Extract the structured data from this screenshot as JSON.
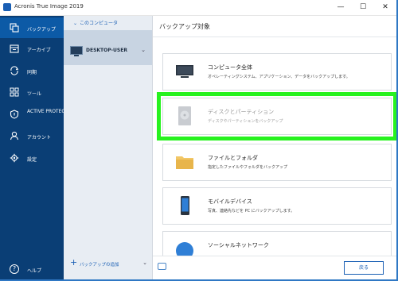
{
  "window": {
    "title": "Acronis True Image 2019",
    "minimize": "—",
    "maximize": "☐",
    "close": "✕"
  },
  "sidebar": {
    "items": [
      {
        "label": "バックアップ",
        "icon": "copy-icon"
      },
      {
        "label": "アーカイブ",
        "icon": "archive-icon"
      },
      {
        "label": "同期",
        "icon": "sync-icon"
      },
      {
        "label": "ツール",
        "icon": "tools-icon"
      },
      {
        "label": "ACTIVE PROTECTION",
        "icon": "shield-icon"
      },
      {
        "label": "アカウント",
        "icon": "person-icon"
      },
      {
        "label": "設定",
        "icon": "gear-icon"
      }
    ],
    "help": "ヘルプ"
  },
  "backups": {
    "header": "このコンピュータ",
    "item": "DESKTOP-USER",
    "add": "バックアップの追加"
  },
  "main": {
    "heading": "バックアップ対象",
    "cards": [
      {
        "title": "コンピュータ全体",
        "desc": "オペレーティングシステム、アプリケーション、データをバックアップします。",
        "icon": "monitor-icon"
      },
      {
        "title": "ディスクとパーティション",
        "desc": "ディスクやパーティションをバックアップ",
        "icon": "hard-disk-icon"
      },
      {
        "title": "ファイルとフォルダ",
        "desc": "指定したファイルやフォルダをバックアップ",
        "icon": "folder-icon"
      },
      {
        "title": "モバイルデバイス",
        "desc": "写真、連絡先などを PC にバックアップします。",
        "icon": "phone-icon"
      },
      {
        "title": "ソーシャルネットワーク",
        "desc": "",
        "icon": "globe-icon"
      }
    ],
    "back": "戻る"
  },
  "colors": {
    "sidebar": "#0a3e75",
    "active": "#0c5aa6",
    "highlight": "#27f21f",
    "accent": "#1a5fb4"
  }
}
